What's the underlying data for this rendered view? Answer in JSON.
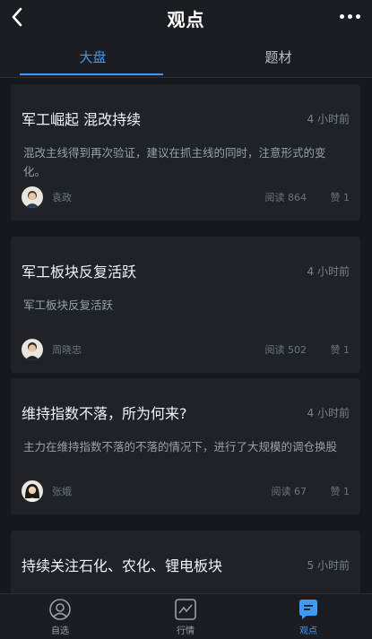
{
  "header": {
    "title": "观点"
  },
  "tabs": [
    {
      "label": "大盘",
      "active": true
    },
    {
      "label": "题材",
      "active": false
    }
  ],
  "posts": [
    {
      "title": "军工崛起 混改持续",
      "time": "4 小时前",
      "body": "混改主线得到再次验证，建议在抓主线的同时，注意形式的变化。",
      "author": "袁政",
      "reads": "阅读 864",
      "likes": "赞 1"
    },
    {
      "title": "军工板块反复活跃",
      "time": "4 小时前",
      "body": "军工板块反复活跃",
      "author": "周晓忠",
      "reads": "阅读 502",
      "likes": "赞 1"
    },
    {
      "title": "维持指数不落，所为何来?",
      "time": "4 小时前",
      "body": "主力在维持指数不落的不落的情况下，进行了大规模的调仓换股",
      "author": "张娥",
      "reads": "阅读 67",
      "likes": "赞 1"
    },
    {
      "title": "持续关注石化、农化、锂电板块",
      "time": "5 小时前",
      "body": "",
      "author": "",
      "reads": "",
      "likes": ""
    }
  ],
  "nav": [
    {
      "label": "自选",
      "icon": "user-circle-icon"
    },
    {
      "label": "行情",
      "icon": "chart-icon"
    },
    {
      "label": "观点",
      "icon": "message-icon",
      "active": true
    }
  ],
  "colors": {
    "accent": "#3d9bf5",
    "background": "#16181d",
    "card": "#1f2227"
  }
}
